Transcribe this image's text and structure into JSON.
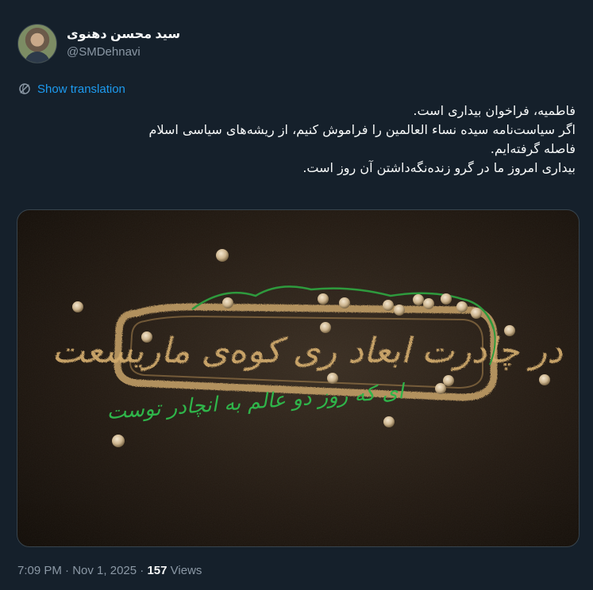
{
  "author": {
    "display_name": "سید محسن دهنوی",
    "handle": "@SMDehnavi"
  },
  "translation": {
    "label": "Show translation",
    "icon": "translate-globe-icon"
  },
  "tweet": {
    "lines": [
      "فاطمیه، فراخوان بیداری است.",
      "اگر سیاست‌نامه سیده نساء العالمین را فراموش کنیم، از ریشه‌های سیاسی اسلام",
      "فاصله گرفته‌ایم.",
      "بیداری امروز ما در گرو زنده‌نگه‌داشتن آن روز است."
    ]
  },
  "media": {
    "calligraphy_main": "در چادرت ابعاد ری کوه‌ی ماریسعت",
    "calligraphy_secondary": "ای که روز دو عالم به انچادر توست",
    "colors": {
      "sand": "#c9a46a",
      "green": "#2fb54a",
      "background": "#231a12"
    }
  },
  "meta": {
    "time": "7:09 PM",
    "separator": "·",
    "date": "Nov 1, 2025",
    "views_count": "157",
    "views_label": "Views"
  },
  "colors": {
    "accent": "#1d9bf0",
    "background": "#15202b",
    "text": "#f7f9f9",
    "muted": "#8b98a5"
  }
}
